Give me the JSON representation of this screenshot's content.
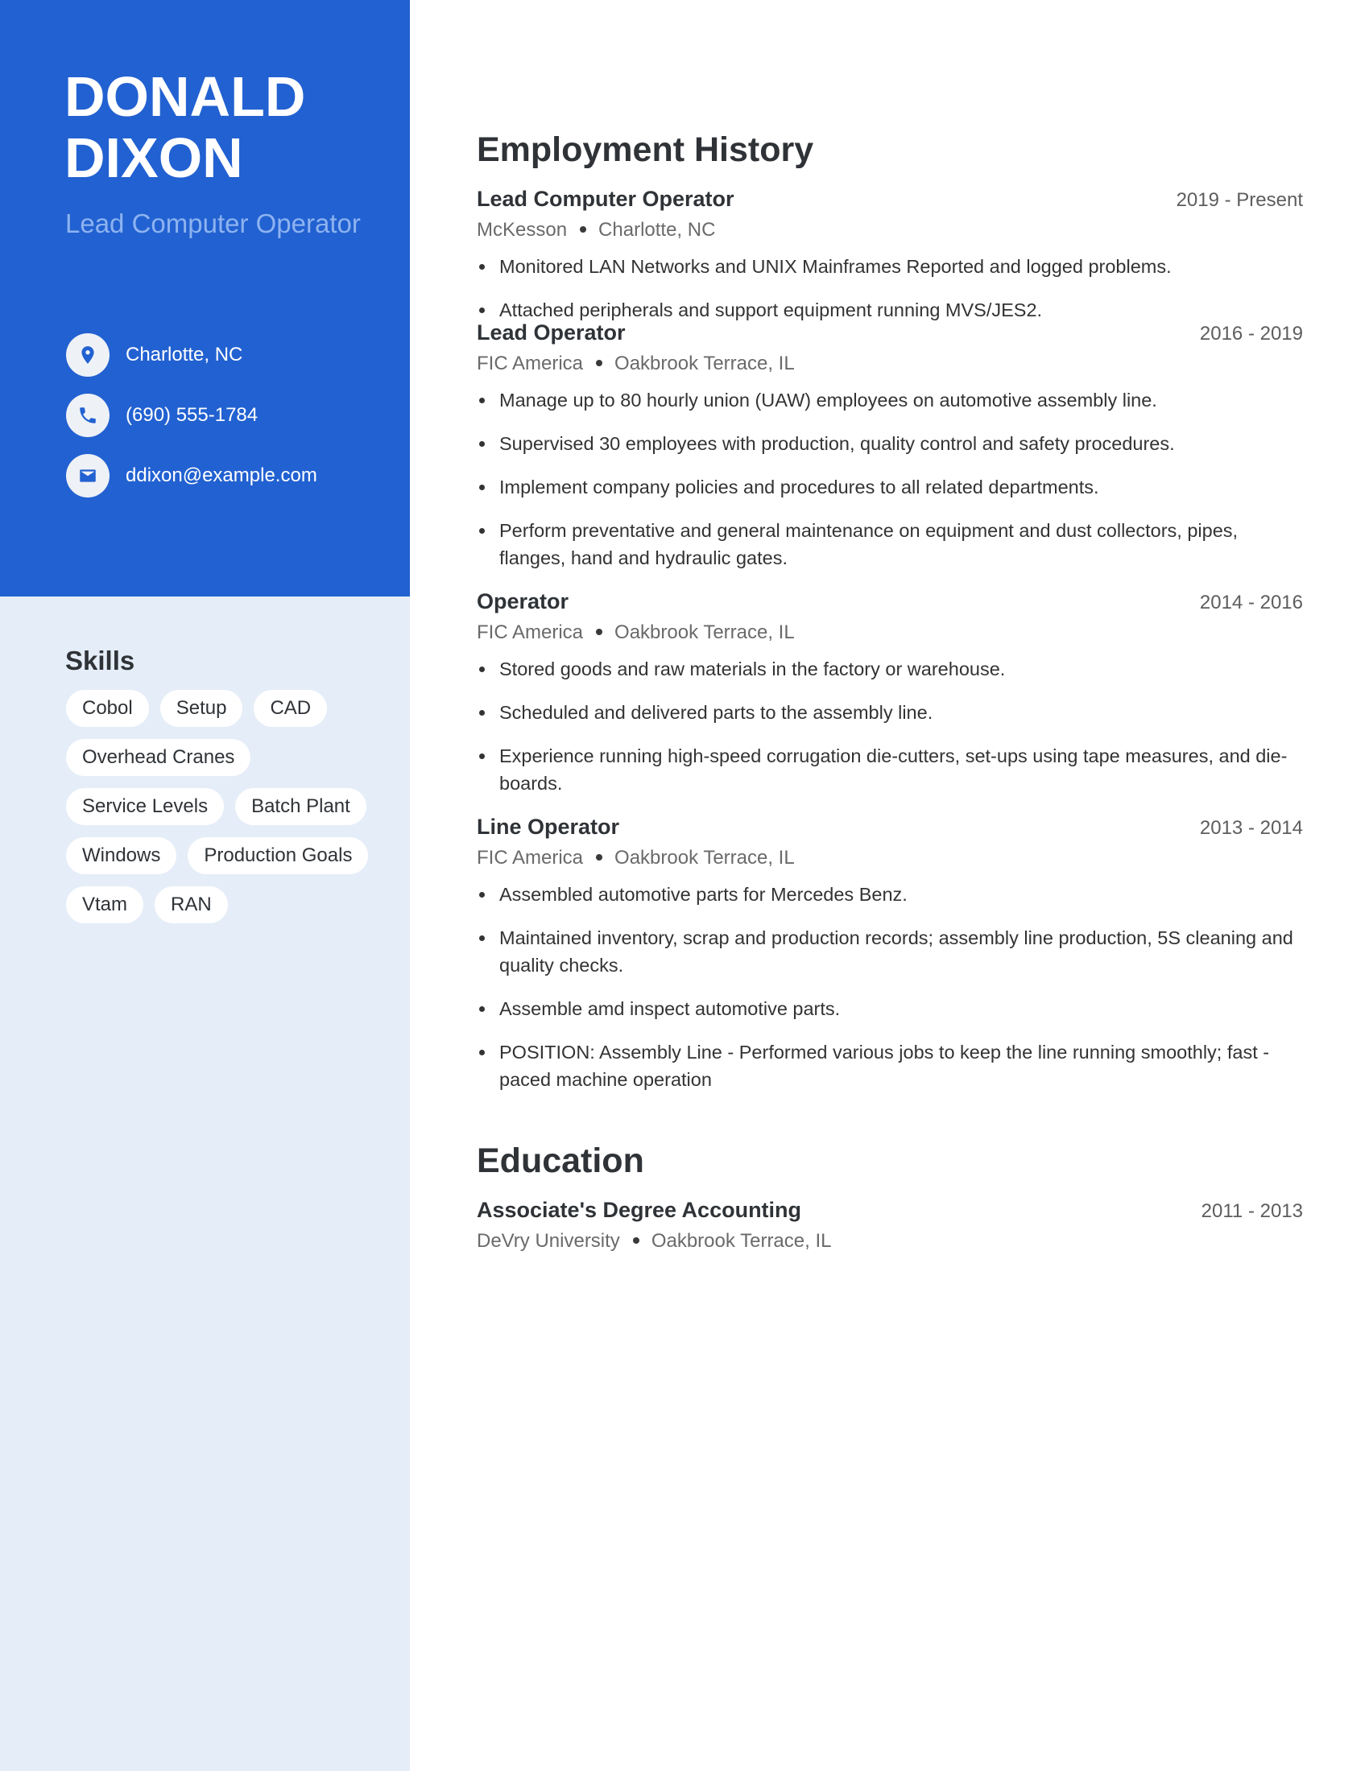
{
  "profile": {
    "first_name": "DONALD",
    "last_name": "DIXON",
    "headline": "Lead Computer Operator",
    "contacts": [
      {
        "icon": "location-pin-icon",
        "text": "Charlotte, NC"
      },
      {
        "icon": "phone-icon",
        "text": "(690) 555-1784"
      },
      {
        "icon": "email-icon",
        "text": "ddixon@example.com"
      }
    ]
  },
  "colors": {
    "accent": "#2261d1",
    "sidebar_bg": "#e5edf8",
    "headline": "#8db3f0"
  },
  "skills": {
    "title": "Skills",
    "items": [
      "Cobol",
      "Setup",
      "CAD",
      "Overhead Cranes",
      "Service Levels",
      "Batch Plant",
      "Windows",
      "Production Goals",
      "Vtam",
      "RAN"
    ]
  },
  "employment": {
    "title": "Employment History",
    "jobs": [
      {
        "title": "Lead Computer Operator",
        "dates": "2019 - Present",
        "company": "McKesson",
        "location": "Charlotte, NC",
        "bullets": [
          "Monitored LAN Networks and UNIX Mainframes Reported and logged problems.",
          "Attached peripherals and support equipment running MVS/JES2."
        ]
      },
      {
        "title": "Lead Operator",
        "dates": "2016 - 2019",
        "company": "FIC America",
        "location": "Oakbrook Terrace, IL",
        "bullets": [
          "Manage up to 80 hourly union (UAW) employees on automotive assembly line.",
          "Supervised 30 employees with production, quality control and safety procedures.",
          "Implement company policies and procedures to all related departments.",
          "Perform preventative and general maintenance on equipment and dust collectors, pipes, flanges, hand and hydraulic gates."
        ]
      },
      {
        "title": "Operator",
        "dates": "2014 - 2016",
        "company": "FIC America",
        "location": "Oakbrook Terrace, IL",
        "bullets": [
          "Stored goods and raw materials in the factory or warehouse.",
          "Scheduled and delivered parts to the assembly line.",
          "Experience running high-speed corrugation die-cutters, set-ups using tape measures, and die-boards."
        ]
      },
      {
        "title": "Line Operator",
        "dates": "2013 - 2014",
        "company": "FIC America",
        "location": "Oakbrook Terrace, IL",
        "bullets": [
          "Assembled automotive parts for Mercedes Benz.",
          "Maintained inventory, scrap and production records; assembly line production, 5S cleaning and quality checks.",
          "Assemble amd inspect automotive parts.",
          "POSITION: Assembly Line - Performed various jobs to keep the line running smoothly; fast - paced machine operation"
        ]
      }
    ]
  },
  "education": {
    "title": "Education",
    "items": [
      {
        "degree": "Associate's Degree Accounting",
        "dates": "2011 - 2013",
        "school": "DeVry University",
        "location": "Oakbrook Terrace, IL"
      }
    ]
  }
}
